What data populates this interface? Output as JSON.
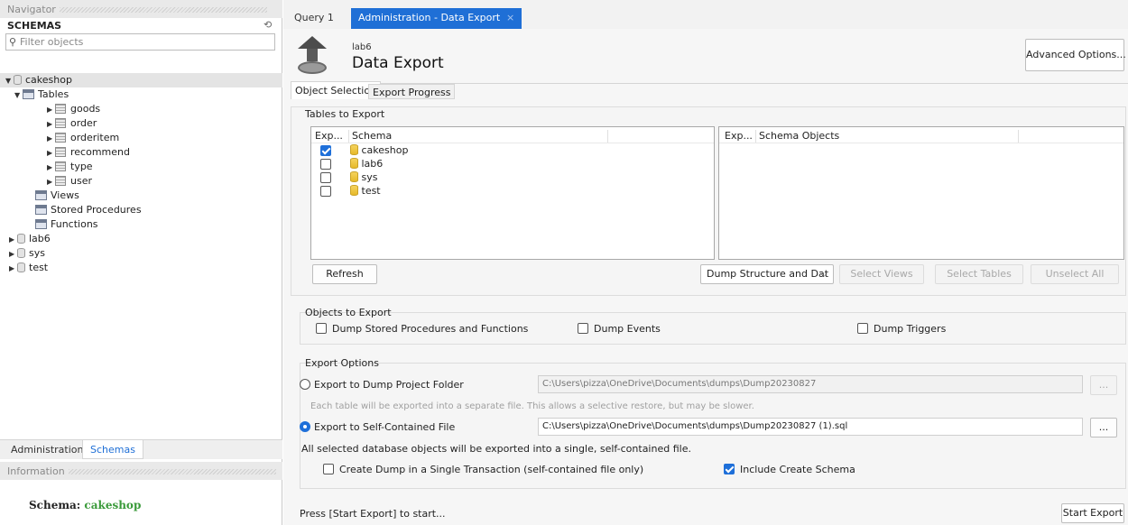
{
  "navigator": {
    "title": "Navigator",
    "schemas_title": "SCHEMAS",
    "filter_placeholder": "Filter objects",
    "db_cakeshop": "cakeshop",
    "tables_label": "Tables",
    "tables": [
      "goods",
      "order",
      "orderitem",
      "recommend",
      "type",
      "user"
    ],
    "views_label": "Views",
    "procs_label": "Stored Procedures",
    "funcs_label": "Functions",
    "other_dbs": [
      "lab6",
      "sys",
      "test"
    ],
    "bottom_tabs": [
      "Administration",
      "Schemas"
    ],
    "info_title": "Information",
    "info_schema_label": "Schema:",
    "info_schema_value": "cakeshop"
  },
  "tabs": [
    "Query 1",
    "Administration - Data Export"
  ],
  "header": {
    "subtitle": "lab6",
    "title": "Data Export",
    "advanced_button": "Advanced Options..."
  },
  "subtabs": [
    "Object Selection",
    "Export Progress"
  ],
  "tables_to_export": {
    "legend": "Tables to Export",
    "left_cols": [
      "Exp...",
      "Schema"
    ],
    "right_cols": [
      "Exp...",
      "Schema Objects"
    ],
    "schemas": [
      {
        "name": "cakeshop",
        "checked": true
      },
      {
        "name": "lab6",
        "checked": false
      },
      {
        "name": "sys",
        "checked": false
      },
      {
        "name": "test",
        "checked": false
      }
    ],
    "refresh": "Refresh",
    "dump_select": "Dump Structure and Dat",
    "select_views": "Select Views",
    "select_tables": "Select Tables",
    "unselect_all": "Unselect All"
  },
  "objects_to_export": {
    "legend": "Objects to Export",
    "dump_procs": "Dump Stored Procedures and Functions",
    "dump_events": "Dump Events",
    "dump_triggers": "Dump Triggers"
  },
  "export_options": {
    "legend": "Export Options",
    "opt_folder": "Export to Dump Project Folder",
    "folder_path": "C:\\Users\\pizza\\OneDrive\\Documents\\dumps\\Dump20230827",
    "folder_note": "Each table will be exported into a separate file. This allows a selective restore, but may be slower.",
    "opt_file": "Export to Self-Contained File",
    "file_path": "C:\\Users\\pizza\\OneDrive\\Documents\\dumps\\Dump20230827 (1).sql",
    "file_note": "All selected database objects will be exported into a single, self-contained file.",
    "single_tx": "Create Dump in a Single Transaction (self-contained file only)",
    "include_schema": "Include Create Schema",
    "browse": "..."
  },
  "footer": {
    "status": "Press [Start Export] to start...",
    "start_button": "Start Export"
  },
  "colors": {
    "accent": "#1e6fd9",
    "tab_active": "#1f6fd6",
    "schema_green": "#3a9a3a"
  }
}
